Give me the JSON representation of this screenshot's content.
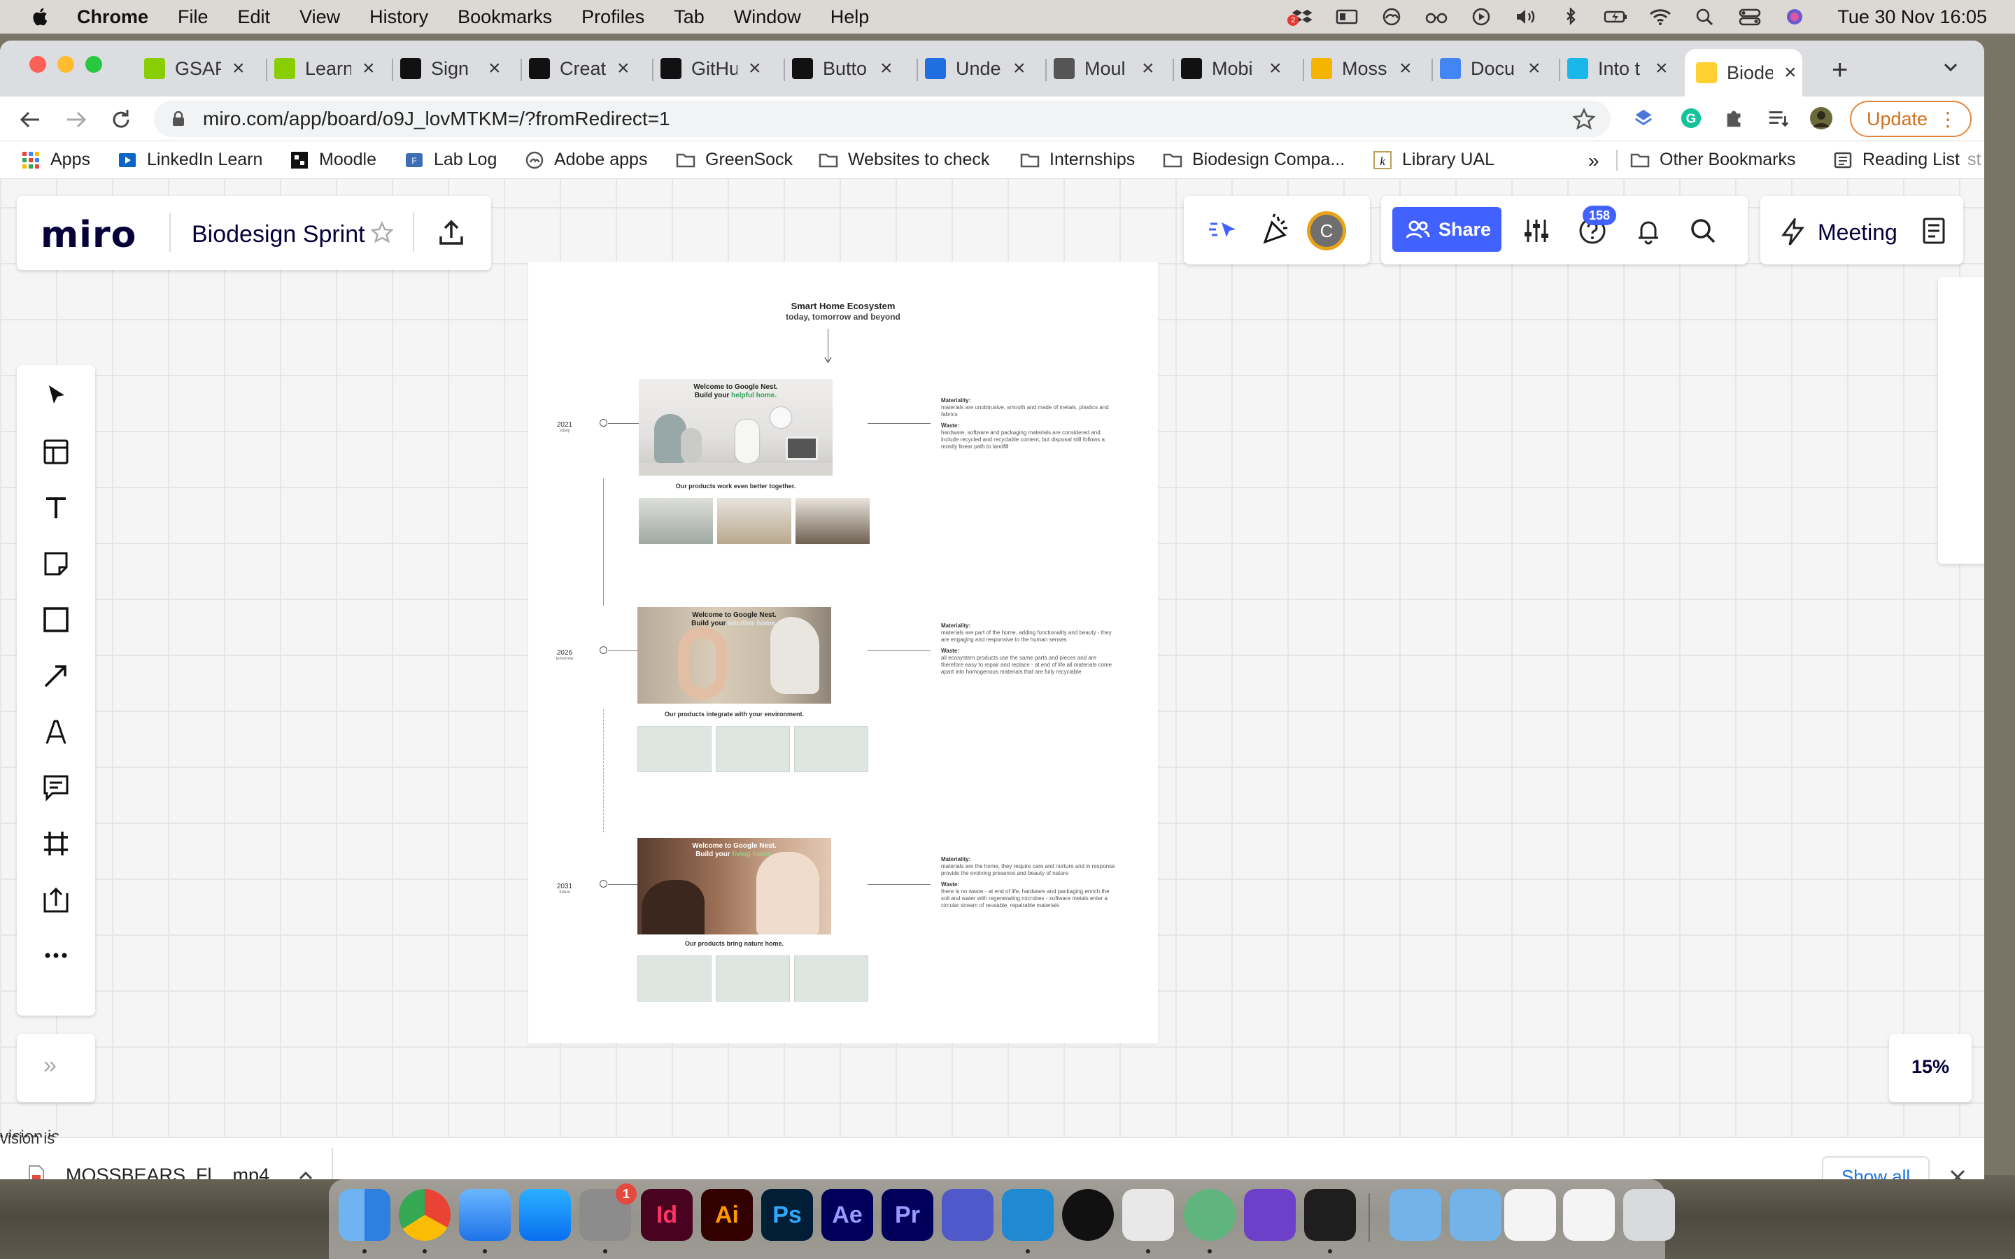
{
  "menubar": {
    "app": "Chrome",
    "items": [
      "File",
      "Edit",
      "View",
      "History",
      "Bookmarks",
      "Profiles",
      "Tab",
      "Window",
      "Help"
    ],
    "clock": "Tue 30 Nov  16:05",
    "notification_badge": "2"
  },
  "tabs": [
    {
      "label": "GSAP",
      "icon": "gsap-icon",
      "color": "#88ce02"
    },
    {
      "label": "Learn",
      "icon": "gsap-icon",
      "color": "#88ce02"
    },
    {
      "label": "Sign",
      "icon": "notion-icon",
      "color": "#111111"
    },
    {
      "label": "Creat",
      "icon": "notion-icon",
      "color": "#111111"
    },
    {
      "label": "GitHub",
      "icon": "github-icon",
      "color": "#111111"
    },
    {
      "label": "Butto",
      "icon": "github-icon",
      "color": "#111111"
    },
    {
      "label": "Unde",
      "icon": "drop-icon",
      "color": "#1f6fe0"
    },
    {
      "label": "Moul",
      "icon": "cube-icon",
      "color": "#555555"
    },
    {
      "label": "Mobi",
      "icon": "mobbin-icon",
      "color": "#111111"
    },
    {
      "label": "Moss",
      "icon": "drive-icon",
      "color": "#f4b400"
    },
    {
      "label": "Docu",
      "icon": "docs-icon",
      "color": "#4285f4"
    },
    {
      "label": "Into t",
      "icon": "vimeo-icon",
      "color": "#1ab7ea"
    },
    {
      "label": "Biode",
      "icon": "miro-icon",
      "color": "#ffd02f"
    }
  ],
  "address": {
    "url": "miro.com/app/board/o9J_lovMTKM=/?fromRedirect=1"
  },
  "update_label": "Update",
  "bookmarks": [
    {
      "label": "Apps",
      "icon": "apps-grid-icon"
    },
    {
      "label": "LinkedIn Learn",
      "icon": "linkedin-icon"
    },
    {
      "label": "Moodle",
      "icon": "moodle-icon"
    },
    {
      "label": "Lab Log",
      "icon": "lablog-icon"
    },
    {
      "label": "Adobe apps",
      "icon": "adobe-icon"
    },
    {
      "label": "GreenSock",
      "icon": "folder-icon"
    },
    {
      "label": "Websites to check",
      "icon": "folder-icon"
    },
    {
      "label": "Internships",
      "icon": "folder-icon"
    },
    {
      "label": "Biodesign Compa...",
      "icon": "folder-icon"
    },
    {
      "label": "Library UAL",
      "icon": "library-icon"
    }
  ],
  "bookmarks_overflow": "»",
  "other_bookmarks": "Other Bookmarks",
  "reading_list": "Reading List",
  "reading_list_cut": "st",
  "miro": {
    "logo": "miro",
    "board_name": "Biodesign Sprint",
    "share_label": "Share",
    "help_badge": "158",
    "avatar_letter": "C",
    "meeting_label": "Meeting",
    "zoom": "15%",
    "collapse_chevron": "»",
    "stray_text": "vision is"
  },
  "board": {
    "title": "Smart Home Ecosystem",
    "subtitle": "today, tomorrow and beyond",
    "rows": [
      {
        "year": "2021",
        "when": "today",
        "hero_line1": "Welcome to Google Nest.",
        "hero_line2_pre": "Build your ",
        "hero_line2_hl": "helpful home.",
        "caption": "Our products work even better together.",
        "materiality": "materials are unobtrusive, smooth and made of metals, plastics and fabrics",
        "waste": "hardware, software and packaging materials are considered and include recycled and recyclable content, but disposal still follows a mostly linear path to landfill"
      },
      {
        "year": "2026",
        "when": "tomorrow",
        "hero_line1": "Welcome to Google Nest.",
        "hero_line2_pre": "Build your ",
        "hero_line2_hl": "intuitive home.",
        "caption": "Our products integrate with your environment.",
        "materiality": "materials are part of the home, adding functionality and beauty - they are engaging and responsive to the human senses",
        "waste": "all ecosystem products use the same parts and pieces and are therefore easy to repair and replace - at end of life all materials come apart into homogenous materials that are fully recyclable"
      },
      {
        "year": "2031",
        "when": "future",
        "hero_line1": "Welcome to Google Nest.",
        "hero_line2_pre": "Build your ",
        "hero_line2_hl": "living home.",
        "caption": "Our products bring nature home.",
        "materiality": "materials are the home, they require care and nurture and in response provide the evolving presence and beauty of nature",
        "waste": "there is no waste - at end of life, hardware and packaging enrich the soil and water with regenerating microbes - software metals enter a circular stream of reusable, repairable materials"
      }
    ],
    "materiality_label": "Materiality:",
    "waste_label": "Waste:"
  },
  "download": {
    "filename": "MOSSBEARS_Fl....mp4",
    "show_all": "Show all"
  },
  "dock": [
    {
      "icon": "finder-icon",
      "label": ""
    },
    {
      "icon": "chrome-icon",
      "label": ""
    },
    {
      "icon": "mail-icon",
      "label": ""
    },
    {
      "icon": "app-store-icon",
      "label": ""
    },
    {
      "icon": "system-preferences-icon",
      "label": "",
      "badge": "1"
    },
    {
      "icon": "indesign-icon",
      "label": "Id",
      "color": "#49021f",
      "fg": "#ff3366"
    },
    {
      "icon": "illustrator-icon",
      "label": "Ai",
      "color": "#330000",
      "fg": "#ff9a00"
    },
    {
      "icon": "photoshop-icon",
      "label": "Ps",
      "color": "#001e36",
      "fg": "#31a8ff"
    },
    {
      "icon": "after-effects-icon",
      "label": "Ae",
      "color": "#00005b",
      "fg": "#9999ff"
    },
    {
      "icon": "premiere-icon",
      "label": "Pr",
      "color": "#00005b",
      "fg": "#9999ff"
    },
    {
      "icon": "teams-icon",
      "label": ""
    },
    {
      "icon": "vscode-icon",
      "label": ""
    },
    {
      "icon": "cinema4d-icon",
      "label": ""
    },
    {
      "icon": "preview-icon",
      "label": ""
    },
    {
      "icon": "atom-icon",
      "label": ""
    },
    {
      "icon": "github-desktop-icon",
      "label": ""
    },
    {
      "icon": "figma-icon",
      "label": ""
    },
    {
      "icon": "applications-folder-icon",
      "label": ""
    },
    {
      "icon": "downloads-folder-icon",
      "label": ""
    },
    {
      "icon": "screenshot-thumb-icon",
      "label": ""
    },
    {
      "icon": "screenshot-thumb-icon",
      "label": ""
    },
    {
      "icon": "trash-icon",
      "label": ""
    }
  ]
}
